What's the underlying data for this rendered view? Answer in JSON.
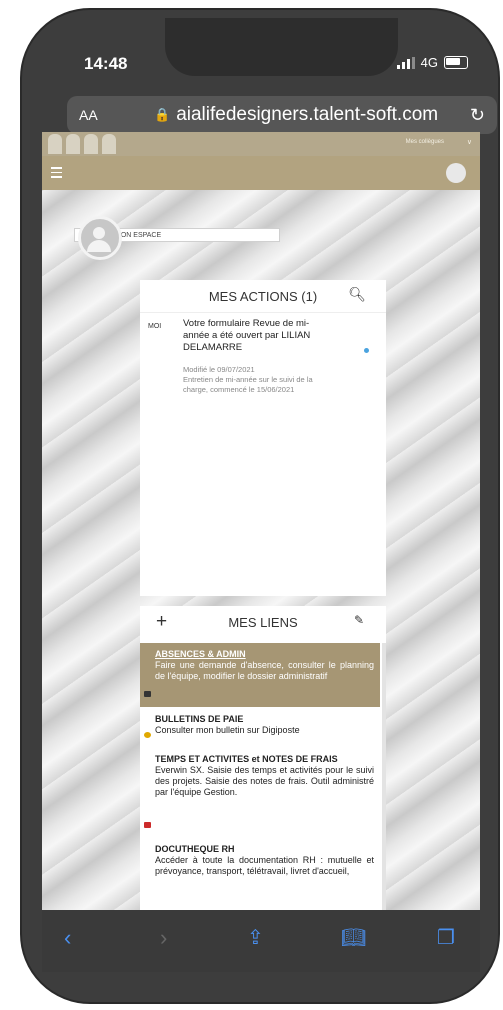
{
  "status": {
    "time": "14:48",
    "network": "4G"
  },
  "browser": {
    "text_size": "AA",
    "url": "aialifedesigners.talent-soft.com"
  },
  "site": {
    "top_right_label": "Mes collègues",
    "mon_espace": "MON ESPACE"
  },
  "actions": {
    "title": "MES ACTIONS (1)",
    "item": {
      "tag": "MOI",
      "title": "Votre formulaire Revue de mi-année a été ouvert par LILIAN DELAMARRE",
      "modified": "Modifié le 09/07/2021",
      "detail": "Entretien de mi-année sur le suivi de la charge, commencé le 15/06/2021"
    }
  },
  "links": {
    "title": "MES LIENS",
    "items": [
      {
        "title": "ABSENCES & ADMIN",
        "desc": "Faire une demande d'absence, consulter le planning de l'équipe, modifier le dossier administratif"
      },
      {
        "title": "BULLETINS DE PAIE",
        "desc": "Consulter mon bulletin sur Digiposte"
      },
      {
        "title": "TEMPS ET ACTIVITES et NOTES DE FRAIS",
        "desc": "Everwin SX. Saisie des temps et activités pour le suivi des projets. Saisie des notes de frais. Outil administré par l'équipe Gestion."
      },
      {
        "title": "DOCUTHEQUE RH",
        "desc": "Accéder à toute la documentation RH : mutuelle et prévoyance, transport, télétravail, livret d'accueil,"
      }
    ]
  },
  "colors": {
    "gold": "#b2a380",
    "link_active": "#a69674",
    "ios_blue": "#4a90f0"
  }
}
